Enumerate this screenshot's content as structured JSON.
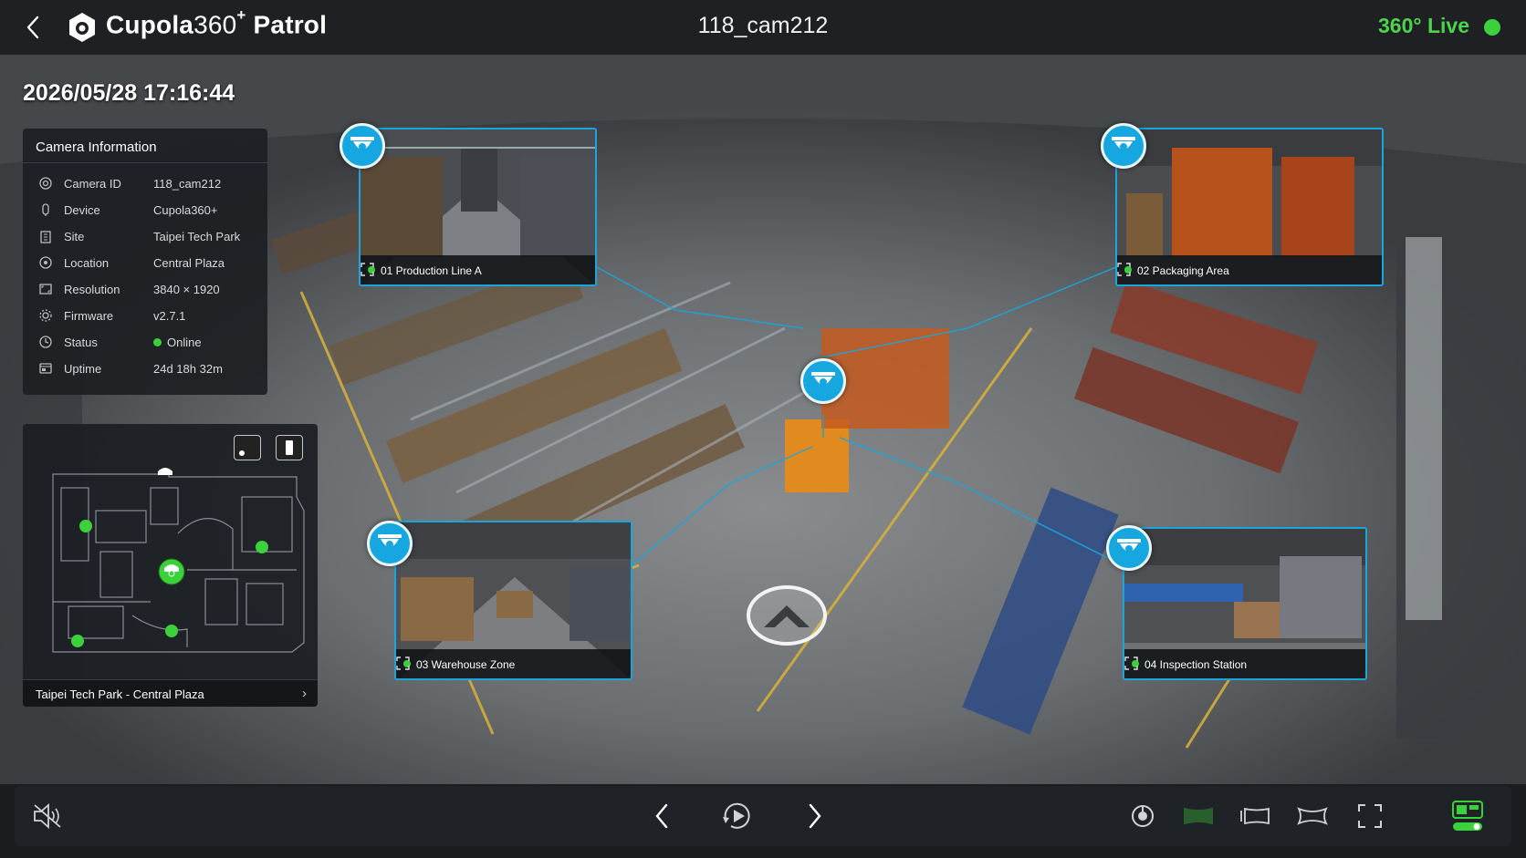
{
  "header": {
    "brand_bold": "Cupola",
    "brand_thin": "360",
    "brand_sup": "+",
    "brand_suffix": " Patrol",
    "camera_title": "118_cam212",
    "live_label": "360° Live"
  },
  "timestamp": "2026/05/28 17:16:44",
  "camera_info": {
    "title": "Camera Information",
    "rows": [
      {
        "icon": "camera-id-icon",
        "key": "Camera ID",
        "value": "118_cam212"
      },
      {
        "icon": "device-icon",
        "key": "Device",
        "value": "Cupola360+"
      },
      {
        "icon": "site-icon",
        "key": "Site",
        "value": "Taipei Tech Park"
      },
      {
        "icon": "location-icon",
        "key": "Location",
        "value": "Central Plaza"
      },
      {
        "icon": "resolution-icon",
        "key": "Resolution",
        "value": "3840 × 1920"
      },
      {
        "icon": "firmware-icon",
        "key": "Firmware",
        "value": "v2.7.1"
      },
      {
        "icon": "status-icon",
        "key": "Status",
        "value": "Online"
      },
      {
        "icon": "uptime-icon",
        "key": "Uptime",
        "value": "24d 18h 32m"
      }
    ]
  },
  "map": {
    "footer_label": "Taipei Tech Park - Central Plaza"
  },
  "previews": [
    {
      "label": "01 Production Line A",
      "status": "online"
    },
    {
      "label": "02 Packaging Area",
      "status": "online"
    },
    {
      "label": "03 Warehouse Zone",
      "status": "online"
    },
    {
      "label": "04 Inspection Station",
      "status": "online"
    }
  ],
  "colors": {
    "accent": "#1aa6dc",
    "live_green": "#3ad13a",
    "active_tool_green": "#3ad13a",
    "panel_bg": "#1e2024"
  },
  "toolbar": {
    "left": [
      "mute-icon"
    ],
    "center": [
      "previous-icon",
      "autoplay-icon",
      "next-icon"
    ],
    "right": [
      "snapshot-icon",
      "view-mode-flat-icon",
      "view-mode-panorama-icon",
      "view-mode-fisheye-icon",
      "fullscreen-icon",
      "layout-toggle-icon"
    ]
  }
}
